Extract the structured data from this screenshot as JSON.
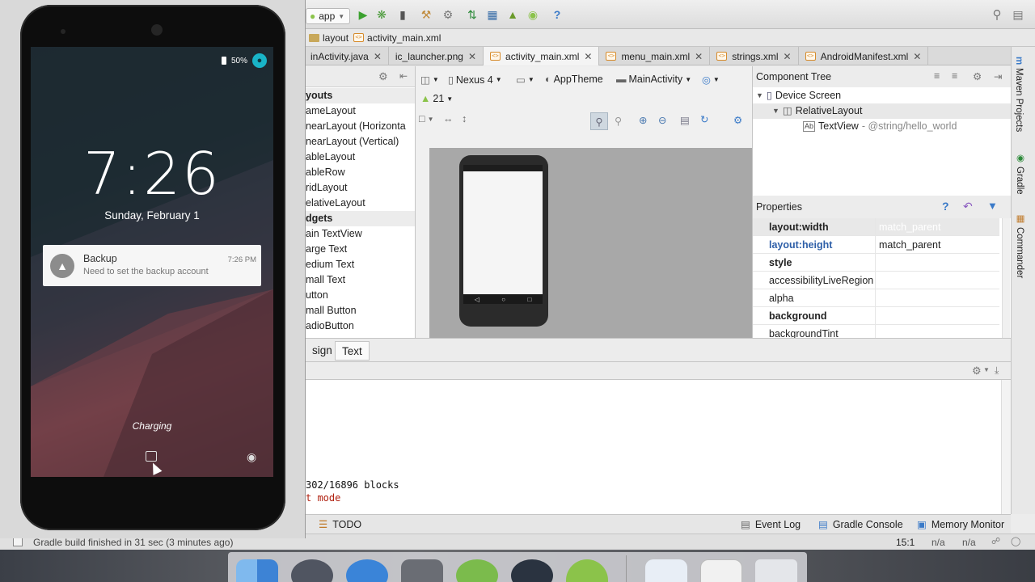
{
  "toolbar": {
    "run_config": "app"
  },
  "breadcrumb": [
    "layout",
    "activity_main.xml"
  ],
  "editor_tabs": [
    {
      "label": "inActivity.java",
      "active": false
    },
    {
      "label": "ic_launcher.png",
      "active": false
    },
    {
      "label": "activity_main.xml",
      "active": true
    },
    {
      "label": "menu_main.xml",
      "active": false
    },
    {
      "label": "strings.xml",
      "active": false
    },
    {
      "label": "AndroidManifest.xml",
      "active": false
    }
  ],
  "palette": {
    "items": [
      {
        "label": "youts",
        "category": true
      },
      {
        "label": "ameLayout",
        "category": false
      },
      {
        "label": "nearLayout (Horizonta",
        "category": false
      },
      {
        "label": "nearLayout (Vertical)",
        "category": false
      },
      {
        "label": "ableLayout",
        "category": false
      },
      {
        "label": "ableRow",
        "category": false
      },
      {
        "label": "ridLayout",
        "category": false
      },
      {
        "label": "elativeLayout",
        "category": false
      },
      {
        "label": "dgets",
        "category": true
      },
      {
        "label": "ain TextView",
        "category": false
      },
      {
        "label": "arge Text",
        "category": false
      },
      {
        "label": "edium Text",
        "category": false
      },
      {
        "label": "mall Text",
        "category": false
      },
      {
        "label": "utton",
        "category": false
      },
      {
        "label": "mall Button",
        "category": false
      },
      {
        "label": "adioButton",
        "category": false
      }
    ]
  },
  "design_toolbar": {
    "device": "Nexus 4",
    "theme": "AppTheme",
    "activity": "MainActivity",
    "api": "21"
  },
  "component_tree": {
    "title": "Component Tree",
    "nodes": [
      {
        "label": "Device Screen",
        "extra": ""
      },
      {
        "label": "RelativeLayout",
        "extra": ""
      },
      {
        "label": "TextView",
        "extra": " - @string/hello_world"
      }
    ]
  },
  "properties": {
    "title": "Properties",
    "rows": [
      {
        "name": "layout:width",
        "value": "match_parent"
      },
      {
        "name": "layout:height",
        "value": "match_parent"
      },
      {
        "name": "style",
        "value": ""
      },
      {
        "name": "accessibilityLiveRegion",
        "value": ""
      },
      {
        "name": "alpha",
        "value": ""
      },
      {
        "name": "background",
        "value": ""
      },
      {
        "name": "backgroundTint",
        "value": ""
      }
    ]
  },
  "bottom_tabs": {
    "design": "sign",
    "text": "Text"
  },
  "console": {
    "lines": [
      "302/16896 blocks",
      "t mode"
    ]
  },
  "tool_windows": {
    "todo": "TODO",
    "event_log": "Event Log",
    "gradle_console": "Gradle Console",
    "memory_monitor": "Memory Monitor"
  },
  "right_strip": [
    "Maven Projects",
    "Gradle",
    "Commander"
  ],
  "status_bar": {
    "message": "Gradle build finished in 31 sec (3 minutes ago)",
    "position": "15:1",
    "na1": "n/a",
    "na2": "n/a"
  },
  "emulator": {
    "battery": "50%",
    "time": "7:26",
    "date": "Sunday, February 1",
    "notification": {
      "title": "Backup",
      "text": "Need to set the backup account",
      "time": "7:26 PM"
    },
    "charging": "Charging"
  },
  "colors": {
    "accent_blue": "#2e5fa8",
    "android_green": "#8bc34a",
    "tab_icon_orange": "#d68a2a"
  }
}
